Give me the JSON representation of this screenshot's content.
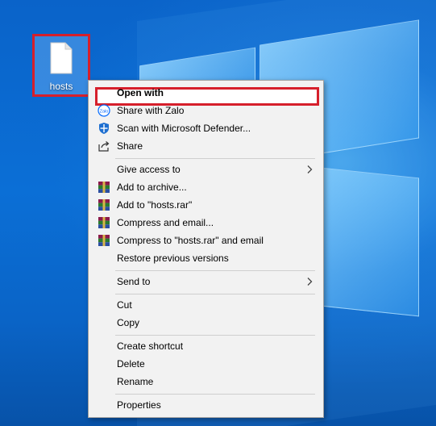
{
  "desktop": {
    "file": {
      "name": "hosts",
      "icon": "document-file-icon"
    }
  },
  "context_menu": {
    "items": [
      {
        "label": "Open with",
        "icon": "",
        "highlighted": true
      },
      {
        "label": "Share with Zalo",
        "icon": "zalo-icon"
      },
      {
        "label": "Scan with Microsoft Defender...",
        "icon": "defender-shield-icon"
      },
      {
        "label": "Share",
        "icon": "share-icon"
      },
      {
        "label": "Give access to",
        "submenu": true
      },
      {
        "label": "Add to archive...",
        "icon": "winrar-icon"
      },
      {
        "label": "Add to \"hosts.rar\"",
        "icon": "winrar-icon"
      },
      {
        "label": "Compress and email...",
        "icon": "winrar-icon"
      },
      {
        "label": "Compress to \"hosts.rar\" and email",
        "icon": "winrar-icon"
      },
      {
        "label": "Restore previous versions"
      },
      {
        "label": "Send to",
        "submenu": true
      },
      {
        "label": "Cut"
      },
      {
        "label": "Copy"
      },
      {
        "label": "Create shortcut"
      },
      {
        "label": "Delete"
      },
      {
        "label": "Rename"
      },
      {
        "label": "Properties"
      }
    ]
  },
  "colors": {
    "highlight_red": "#d61f2b",
    "menu_background": "#f2f2f2",
    "desktop_blue": "#0b6fd6"
  }
}
